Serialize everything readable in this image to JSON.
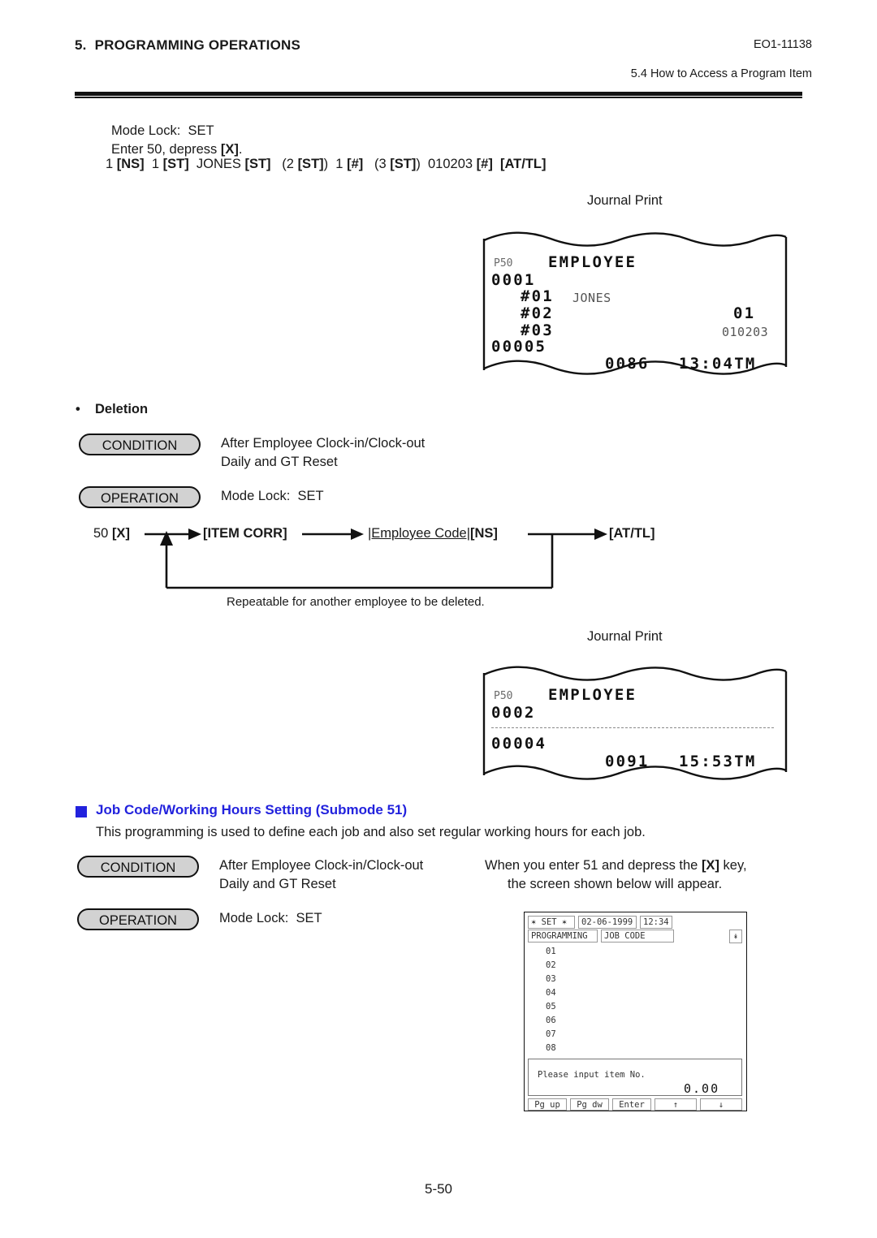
{
  "header": {
    "section_number": "5.",
    "section_title": "PROGRAMMING OPERATIONS",
    "doc_code": "EO1-11138",
    "subsection": "5.4  How to Access a Program Item"
  },
  "intro": {
    "mode_lock": "Mode Lock:  SET",
    "enter_line_a": "Enter 50, depress ",
    "enter_key": "[X]",
    "enter_line_b": ".",
    "key_sequence": [
      {
        "text": "1 ",
        "bold": false
      },
      {
        "text": "[NS]",
        "bold": true
      },
      {
        "text": "  1 ",
        "bold": false
      },
      {
        "text": "[ST]",
        "bold": true
      },
      {
        "text": "  JONES ",
        "bold": false
      },
      {
        "text": "[ST]",
        "bold": true
      },
      {
        "text": "   (2 ",
        "bold": false
      },
      {
        "text": "[ST]",
        "bold": true
      },
      {
        "text": ")  1 ",
        "bold": false
      },
      {
        "text": "[#]",
        "bold": true
      },
      {
        "text": "   (3 ",
        "bold": false
      },
      {
        "text": "[ST]",
        "bold": true
      },
      {
        "text": ")  010203 ",
        "bold": false
      },
      {
        "text": "[#]",
        "bold": true
      },
      {
        "text": "  ",
        "bold": false
      },
      {
        "text": "[AT/TL]",
        "bold": true
      }
    ]
  },
  "journal1": {
    "label": "Journal Print",
    "prog_no": "P50",
    "title": "EMPLOYEE",
    "record_no": "0001",
    "rows": [
      {
        "field": "#01",
        "value": "JONES",
        "align": "left"
      },
      {
        "field": "#02",
        "value": "01",
        "align": "right-big"
      },
      {
        "field": "#03",
        "value": "010203",
        "align": "right-small"
      }
    ],
    "counter": "00005",
    "footer_no": "0086",
    "footer_time": "13:04TM"
  },
  "deletion": {
    "bullet": "•",
    "title": "Deletion",
    "condition_badge": "CONDITION",
    "condition_line1": "After Employee Clock-in/Clock-out",
    "condition_line2": "Daily and GT Reset",
    "operation_badge": "OPERATION",
    "operation_line1": "Mode Lock:  SET",
    "flow": {
      "start_plain": "50 ",
      "start_key": "[X]",
      "step2": "[ITEM CORR]",
      "step3_code": "|Employee Code|",
      "step3_key": "[NS]",
      "step4": "[AT/TL]",
      "loop_note": "Repeatable for another employee to be deleted."
    }
  },
  "journal2": {
    "label": "Journal Print",
    "prog_no": "P50",
    "title": "EMPLOYEE",
    "record_no": "0002",
    "counter": "00004",
    "footer_no": "0091",
    "footer_time": "15:53TM"
  },
  "jobcode": {
    "heading": "Job Code/Working Hours Setting (Submode 51)",
    "description": "This programming is used to define each job and also set regular working hours for each job.",
    "condition_badge": "CONDITION",
    "condition_line1": "After Employee Clock-in/Clock-out",
    "condition_line2": "Daily and GT Reset",
    "operation_badge": "OPERATION",
    "operation_line1": "Mode Lock:  SET",
    "note_line1_a": "When you enter 51 and depress the ",
    "note_line1_key": "[X]",
    "note_line1_b": " key,",
    "note_line2": "the screen shown below will appear."
  },
  "lcd": {
    "mode": "✶ SET ✶",
    "date": "02-06-1999",
    "time": "12:34",
    "app": "PROGRAMMING",
    "screen": "JOB CODE",
    "scroll_icon": "↡",
    "items": [
      "01",
      "02",
      "03",
      "04",
      "05",
      "06",
      "07",
      "08"
    ],
    "prompt": "Please input item No.",
    "value": "0.00",
    "function_keys": [
      "Pg up",
      "Pg dw",
      "Enter",
      "↑",
      "↓"
    ]
  },
  "footer": {
    "page": "5-50"
  },
  "colors": {
    "heading_blue": "#2222dd",
    "badge_fill": "#d2d2d2",
    "ink": "#111111"
  }
}
